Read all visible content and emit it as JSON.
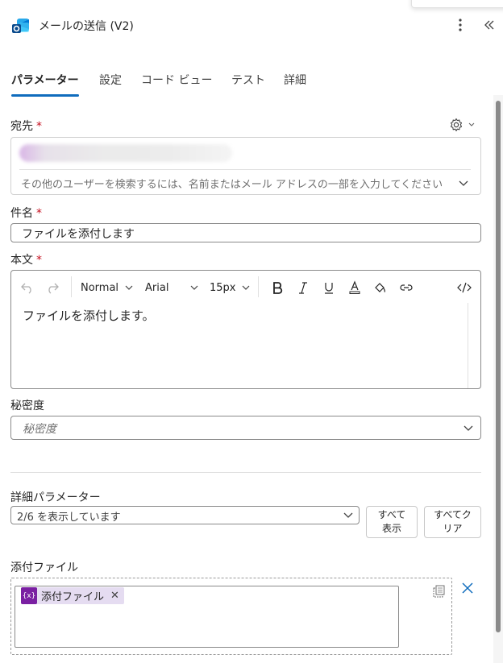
{
  "header": {
    "title": "メールの送信 (V2)"
  },
  "tabs": [
    {
      "label": "パラメーター",
      "active": true
    },
    {
      "label": "設定"
    },
    {
      "label": "コード ビュー"
    },
    {
      "label": "テスト"
    },
    {
      "label": "詳細"
    }
  ],
  "fields": {
    "to": {
      "label": "宛先",
      "required_mark": "*",
      "placeholder": "その他のユーザーを検索するには、名前またはメール アドレスの一部を入力してください"
    },
    "subject": {
      "label": "件名",
      "required_mark": "*",
      "value": "ファイルを添付します"
    },
    "body": {
      "label": "本文",
      "required_mark": "*",
      "toolbar": {
        "format": "Normal",
        "font": "Arial",
        "size": "15px"
      },
      "content": "ファイルを添付します。"
    },
    "importance": {
      "label": "秘密度",
      "placeholder": "秘密度"
    }
  },
  "advanced": {
    "label": "詳細パラメーター",
    "summary": "2/6 を表示しています",
    "show_all_line1": "すべて",
    "show_all_line2": "表示",
    "clear_all_line1": "すべてク",
    "clear_all_line2": "リア"
  },
  "attachments": {
    "label": "添付ファイル",
    "token_icon_text": "{x}",
    "token_label": "添付ファイル"
  },
  "colors": {
    "accent": "#0f6cbd",
    "required": "#c50f1f",
    "token_bg": "#e5dcf1",
    "token_icon": "#7a1fa2"
  }
}
